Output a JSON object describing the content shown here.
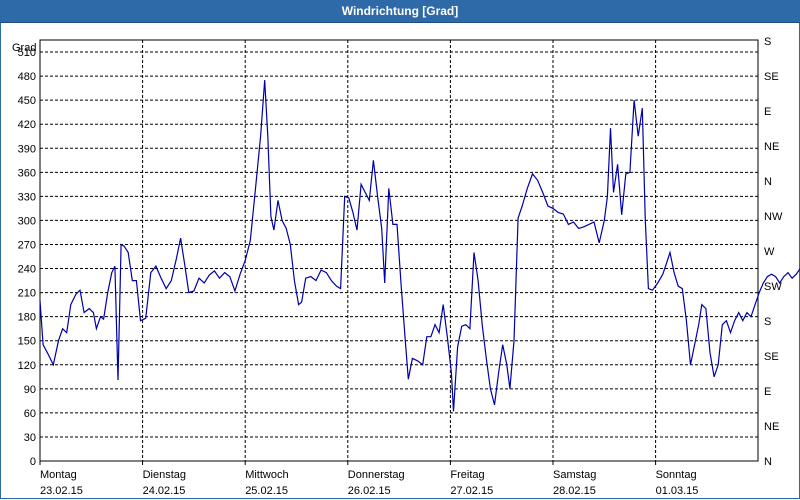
{
  "window": {
    "title": "Windrichtung [Grad]"
  },
  "chart_data": {
    "type": "line",
    "ylabel": "Grad",
    "ylim": [
      0,
      525
    ],
    "y_ticks": [
      0,
      30,
      60,
      90,
      120,
      150,
      180,
      210,
      240,
      270,
      300,
      330,
      360,
      390,
      420,
      450,
      480,
      510
    ],
    "right_axis_labels": [
      "N",
      "NE",
      "E",
      "SE",
      "S",
      "SW",
      "W",
      "NW",
      "N",
      "NE",
      "E",
      "SE",
      "S"
    ],
    "right_axis_values": [
      0,
      45,
      90,
      135,
      180,
      225,
      270,
      315,
      360,
      405,
      450,
      495,
      540
    ],
    "x_unit": "days",
    "xlim": [
      0,
      7
    ],
    "x_ticks": [
      {
        "x": 0,
        "day": "Montag",
        "date": "23.02.15"
      },
      {
        "x": 1,
        "day": "Dienstag",
        "date": "24.02.15"
      },
      {
        "x": 2,
        "day": "Mittwoch",
        "date": "25.02.15"
      },
      {
        "x": 3,
        "day": "Donnerstag",
        "date": "26.02.15"
      },
      {
        "x": 4,
        "day": "Freitag",
        "date": "27.02.15"
      },
      {
        "x": 5,
        "day": "Samstag",
        "date": "28.02.15"
      },
      {
        "x": 6,
        "day": "Sonntag",
        "date": "01.03.15"
      }
    ],
    "grid": true,
    "series": [
      {
        "color": "#0000aa",
        "points": [
          [
            0.0,
            200
          ],
          [
            0.03,
            145
          ],
          [
            0.08,
            133
          ],
          [
            0.13,
            120
          ],
          [
            0.18,
            150
          ],
          [
            0.22,
            165
          ],
          [
            0.26,
            160
          ],
          [
            0.3,
            195
          ],
          [
            0.35,
            208
          ],
          [
            0.39,
            213
          ],
          [
            0.43,
            185
          ],
          [
            0.48,
            190
          ],
          [
            0.52,
            185
          ],
          [
            0.55,
            165
          ],
          [
            0.59,
            180
          ],
          [
            0.62,
            177
          ],
          [
            0.66,
            210
          ],
          [
            0.7,
            235
          ],
          [
            0.73,
            243
          ],
          [
            0.76,
            101
          ],
          [
            0.79,
            270
          ],
          [
            0.82,
            268
          ],
          [
            0.86,
            260
          ],
          [
            0.9,
            225
          ],
          [
            0.94,
            225
          ],
          [
            0.98,
            175
          ],
          [
            1.03,
            178
          ],
          [
            1.08,
            235
          ],
          [
            1.13,
            243
          ],
          [
            1.18,
            228
          ],
          [
            1.23,
            215
          ],
          [
            1.28,
            225
          ],
          [
            1.33,
            253
          ],
          [
            1.37,
            278
          ],
          [
            1.41,
            245
          ],
          [
            1.45,
            210
          ],
          [
            1.5,
            212
          ],
          [
            1.55,
            228
          ],
          [
            1.6,
            222
          ],
          [
            1.65,
            232
          ],
          [
            1.7,
            237
          ],
          [
            1.75,
            228
          ],
          [
            1.8,
            235
          ],
          [
            1.85,
            230
          ],
          [
            1.9,
            212
          ],
          [
            1.95,
            233
          ],
          [
            2.0,
            250
          ],
          [
            2.05,
            275
          ],
          [
            2.1,
            340
          ],
          [
            2.15,
            405
          ],
          [
            2.19,
            475
          ],
          [
            2.22,
            405
          ],
          [
            2.25,
            305
          ],
          [
            2.28,
            288
          ],
          [
            2.32,
            325
          ],
          [
            2.36,
            300
          ],
          [
            2.4,
            290
          ],
          [
            2.44,
            270
          ],
          [
            2.48,
            225
          ],
          [
            2.52,
            195
          ],
          [
            2.55,
            198
          ],
          [
            2.59,
            228
          ],
          [
            2.64,
            230
          ],
          [
            2.69,
            225
          ],
          [
            2.74,
            238
          ],
          [
            2.79,
            235
          ],
          [
            2.84,
            225
          ],
          [
            2.89,
            218
          ],
          [
            2.93,
            215
          ],
          [
            2.97,
            330
          ],
          [
            3.01,
            328
          ],
          [
            3.05,
            310
          ],
          [
            3.09,
            288
          ],
          [
            3.13,
            345
          ],
          [
            3.17,
            335
          ],
          [
            3.21,
            325
          ],
          [
            3.25,
            375
          ],
          [
            3.29,
            330
          ],
          [
            3.33,
            290
          ],
          [
            3.36,
            222
          ],
          [
            3.4,
            340
          ],
          [
            3.44,
            295
          ],
          [
            3.48,
            295
          ],
          [
            3.52,
            218
          ],
          [
            3.56,
            150
          ],
          [
            3.59,
            102
          ],
          [
            3.63,
            128
          ],
          [
            3.68,
            125
          ],
          [
            3.73,
            120
          ],
          [
            3.77,
            155
          ],
          [
            3.81,
            155
          ],
          [
            3.85,
            170
          ],
          [
            3.89,
            160
          ],
          [
            3.93,
            195
          ],
          [
            3.97,
            155
          ],
          [
            4.01,
            110
          ],
          [
            4.03,
            62
          ],
          [
            4.07,
            142
          ],
          [
            4.11,
            168
          ],
          [
            4.15,
            170
          ],
          [
            4.19,
            165
          ],
          [
            4.23,
            260
          ],
          [
            4.27,
            225
          ],
          [
            4.31,
            170
          ],
          [
            4.35,
            128
          ],
          [
            4.39,
            90
          ],
          [
            4.43,
            70
          ],
          [
            4.47,
            110
          ],
          [
            4.51,
            145
          ],
          [
            4.55,
            120
          ],
          [
            4.58,
            90
          ],
          [
            4.62,
            150
          ],
          [
            4.66,
            303
          ],
          [
            4.7,
            318
          ],
          [
            4.75,
            340
          ],
          [
            4.8,
            358
          ],
          [
            4.85,
            350
          ],
          [
            4.9,
            335
          ],
          [
            4.95,
            318
          ],
          [
            5.0,
            315
          ],
          [
            5.05,
            310
          ],
          [
            5.1,
            308
          ],
          [
            5.15,
            295
          ],
          [
            5.2,
            298
          ],
          [
            5.25,
            290
          ],
          [
            5.3,
            292
          ],
          [
            5.35,
            295
          ],
          [
            5.4,
            298
          ],
          [
            5.45,
            272
          ],
          [
            5.5,
            300
          ],
          [
            5.53,
            330
          ],
          [
            5.56,
            415
          ],
          [
            5.59,
            335
          ],
          [
            5.63,
            370
          ],
          [
            5.67,
            307
          ],
          [
            5.71,
            358
          ],
          [
            5.75,
            360
          ],
          [
            5.79,
            450
          ],
          [
            5.83,
            405
          ],
          [
            5.87,
            440
          ],
          [
            5.9,
            300
          ],
          [
            5.93,
            215
          ],
          [
            5.97,
            213
          ],
          [
            6.02,
            222
          ],
          [
            6.07,
            233
          ],
          [
            6.11,
            248
          ],
          [
            6.14,
            260
          ],
          [
            6.18,
            235
          ],
          [
            6.22,
            218
          ],
          [
            6.26,
            215
          ],
          [
            6.3,
            175
          ],
          [
            6.34,
            120
          ],
          [
            6.38,
            145
          ],
          [
            6.42,
            170
          ],
          [
            6.45,
            195
          ],
          [
            6.49,
            190
          ],
          [
            6.53,
            135
          ],
          [
            6.57,
            105
          ],
          [
            6.61,
            120
          ],
          [
            6.65,
            170
          ],
          [
            6.69,
            175
          ],
          [
            6.73,
            160
          ],
          [
            6.77,
            175
          ],
          [
            6.81,
            185
          ],
          [
            6.85,
            175
          ],
          [
            6.89,
            185
          ],
          [
            6.93,
            180
          ],
          [
            6.97,
            195
          ],
          [
            7.01,
            210
          ],
          [
            7.05,
            222
          ],
          [
            7.09,
            230
          ],
          [
            7.13,
            233
          ],
          [
            7.17,
            230
          ],
          [
            7.21,
            222
          ],
          [
            7.25,
            230
          ],
          [
            7.29,
            235
          ],
          [
            7.33,
            228
          ],
          [
            7.37,
            233
          ],
          [
            7.41,
            240
          ],
          [
            7.45,
            245
          ],
          [
            7.49,
            248
          ],
          [
            7.53,
            240
          ],
          [
            7.56,
            235
          ]
        ]
      }
    ]
  }
}
